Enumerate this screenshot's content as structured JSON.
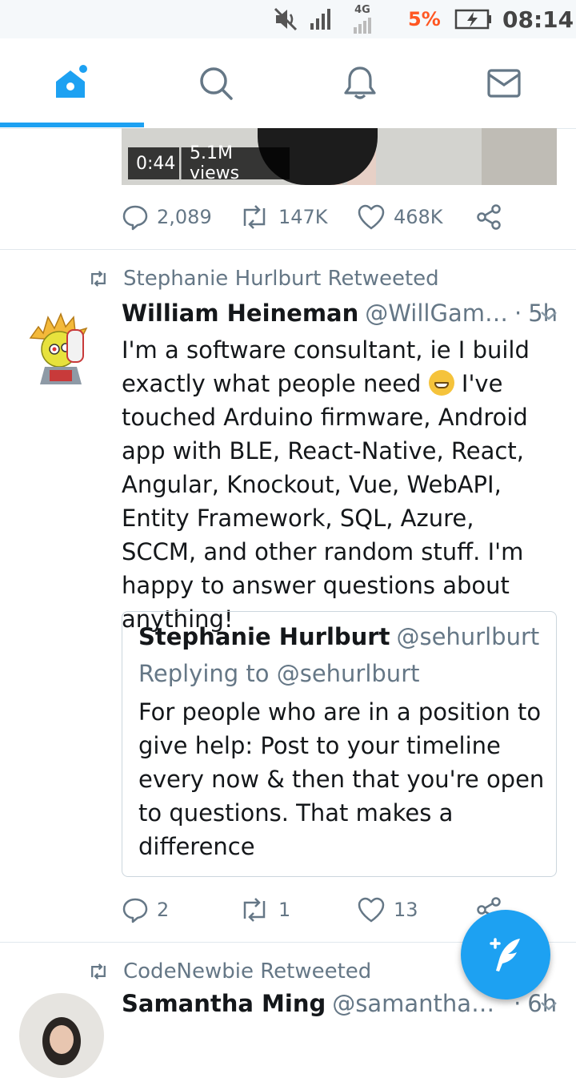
{
  "status_bar": {
    "network": "4G",
    "battery_percent": "5%",
    "time": "08:14"
  },
  "nav": {
    "tabs": [
      {
        "icon": "home-icon",
        "active": true
      },
      {
        "icon": "search-icon",
        "active": false
      },
      {
        "icon": "bell-icon",
        "active": false
      },
      {
        "icon": "mail-icon",
        "active": false
      }
    ]
  },
  "prev_tweet": {
    "video_duration": "0:44",
    "video_views": "5.1M views",
    "replies": "2,089",
    "retweets": "147K",
    "likes": "468K"
  },
  "tweet1": {
    "retweeted_by": "Stephanie Hurlburt Retweeted",
    "name": "William Heineman",
    "handle": "@WillGam…",
    "dot": "·",
    "time": "5h",
    "text_part1": "I'm a software consultant, ie I build exactly what people need",
    "text_part2": "I've touched Arduino firmware, Android app with BLE, React-Native, React, Angular, Knockout, Vue, WebAPI, Entity Framework, SQL, Azure, SCCM, and other random stuff. I'm happy to answer questions about anything!",
    "quote": {
      "name": "Stephanie Hurlburt",
      "handle": "@sehurlburt",
      "reply_to": "Replying to @sehurlburt",
      "text": "For people who are in a position to give help: Post to your timeline every now & then that you're open to questions. That makes a difference"
    },
    "replies": "2",
    "retweets": "1",
    "likes": "13"
  },
  "tweet2": {
    "retweeted_by": "CodeNewbie Retweeted",
    "name": "Samantha Ming",
    "handle": "@samantha…",
    "dot": "·",
    "time": "6h"
  },
  "colors": {
    "accent": "#1da1f2",
    "secondary_text": "#657786",
    "battery_low": "#ff5722"
  }
}
